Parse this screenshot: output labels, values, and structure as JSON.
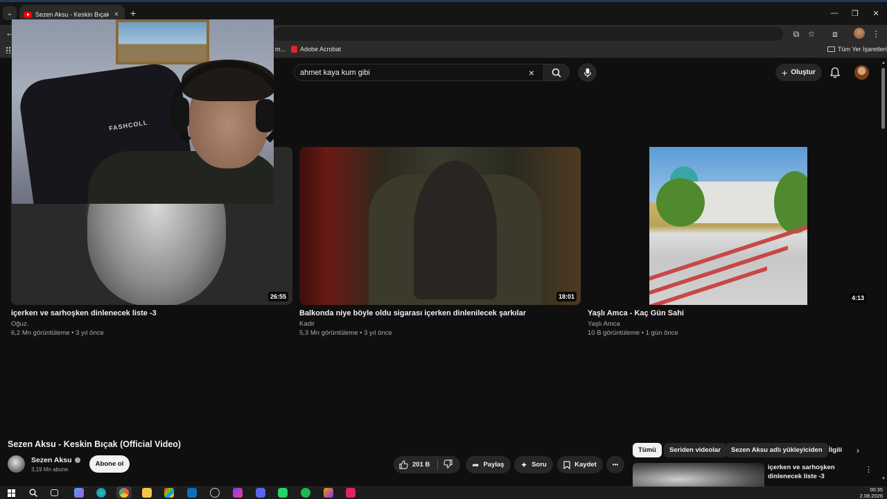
{
  "browser": {
    "tab_title": "Sezen Aksu - Keskin Bıçak (Official Video)",
    "tab_close": "×",
    "new_tab": "+",
    "window_controls": [
      "—",
      "❐",
      "✕"
    ]
  },
  "bookmarks": {
    "truncated_item": "m...",
    "acrobat": "Adobe Acrobat",
    "all_bookmarks": "Tüm Yer İşaretleri"
  },
  "youtube": {
    "search_value": "ahmet kaya kum gibi",
    "search_clear": "×",
    "create_label": "Oluştur"
  },
  "videos": [
    {
      "title": "içerken ve sarhoşken dinlenecek liste -3",
      "channel": "Oğuz.",
      "meta": "6,2 Mn görüntüleme • 3 yıl önce",
      "duration": "26:55"
    },
    {
      "title": "Balkonda niye böyle oldu sigarası içerken dinlenilecek şarkılar",
      "channel": "Kadir",
      "meta": "5,3 Mn görüntüleme • 3 yıl önce",
      "duration": "18:01"
    },
    {
      "title": "Yaşlı Amca - Kaç Gün Sahi",
      "channel": "Yaşlı Amca",
      "meta": "10 B görüntüleme • 1 gün önce",
      "duration": "4:13"
    }
  ],
  "webcam": {
    "chair_text": "FASHCOLL"
  },
  "now_playing": {
    "title": "Sezen Aksu - Keskin Bıçak (Official Video)",
    "channel": "Sezen Aksu",
    "subscribers": "3,19 Mn abone",
    "subscribe_label": "Abone ol",
    "likes": "201 B",
    "share_label": "Paylaş",
    "ask_label": "Soru",
    "save_label": "Kaydet",
    "more_label": "•••"
  },
  "related": {
    "chips": [
      "Tümü",
      "Seriden videolar",
      "Sezen Aksu adlı yükleyiciden",
      "İlgili"
    ],
    "first_title": "içerken ve sarhoşken dinlenecek liste -3",
    "more": "⋮"
  },
  "taskbar": {
    "time": "00:35",
    "date": "2.08.2026"
  },
  "colors": {
    "youtube_red": "#ff0000",
    "background": "#0f0f0f",
    "pill": "#272727"
  }
}
